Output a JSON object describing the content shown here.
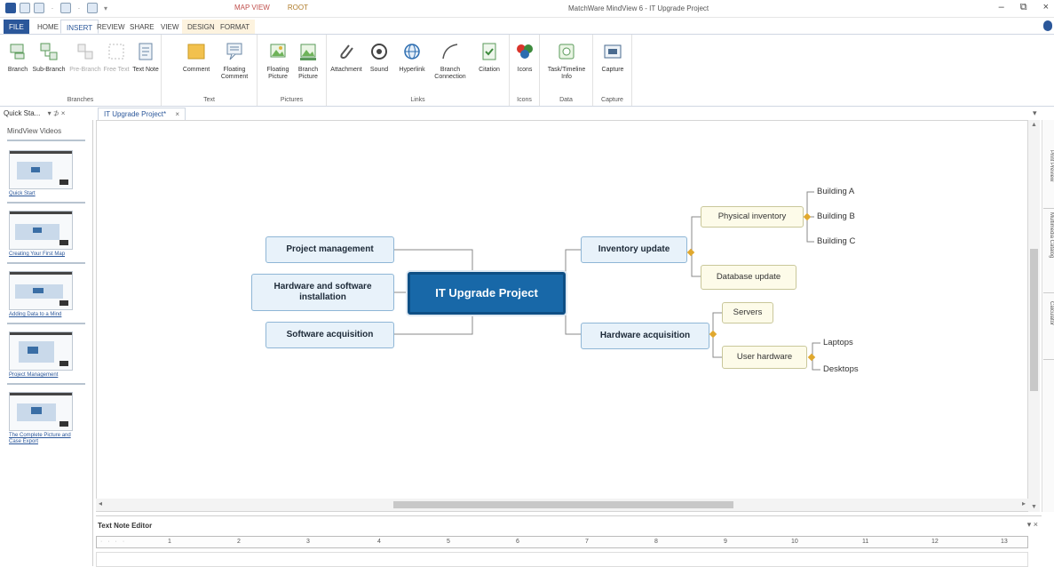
{
  "window": {
    "title": "MatchWare MindView 6 - IT Upgrade Project",
    "context_tab_label": "MAP VIEW",
    "context_tab_root": "ROOT",
    "controls": {
      "minimize": "–",
      "restore": "⧉",
      "close": "×"
    }
  },
  "ribbon_tabs": [
    "FILE",
    "HOME",
    "INSERT",
    "REVIEW",
    "SHARE",
    "VIEW",
    "DESIGN",
    "FORMAT"
  ],
  "active_tab": "INSERT",
  "ribbon": {
    "groups": [
      {
        "label": "Branches",
        "buttons": [
          "Branch",
          "Sub-Branch",
          "Pre-Branch",
          "Free Text",
          "Text Note"
        ]
      },
      {
        "label": "Text",
        "buttons": [
          "Comment",
          "Floating Comment"
        ]
      },
      {
        "label": "Pictures",
        "buttons": [
          "Floating Picture",
          "Branch Picture"
        ]
      },
      {
        "label": "Links",
        "buttons": [
          "Attachment",
          "Sound",
          "Hyperlink",
          "Branch Connection",
          "Citation"
        ]
      },
      {
        "label": "Icons",
        "buttons": [
          "Icons"
        ]
      },
      {
        "label": "Data",
        "buttons": [
          "Task/Timeline Info"
        ]
      },
      {
        "label": "Capture",
        "buttons": [
          "Capture"
        ]
      }
    ]
  },
  "quick_start": {
    "header": "Quick Sta...",
    "header_controls": "▾ ⊅ ×",
    "title": "MindView Videos",
    "items": [
      {
        "caption": "Quick Start"
      },
      {
        "caption": "Creating Your First Map"
      },
      {
        "caption": "Adding Data to a Mind"
      },
      {
        "caption": "Project Management"
      },
      {
        "caption": "The Complete Picture and Case Export"
      }
    ]
  },
  "document_tab": {
    "label": "IT Upgrade Project*",
    "close": "×"
  },
  "mindmap": {
    "central": "IT Upgrade Project",
    "left_branches": [
      "Project management",
      "Hardware and software installation",
      "Software acquisition"
    ],
    "right_branches": [
      {
        "label": "Inventory update",
        "children": [
          {
            "label": "Physical inventory",
            "children": [
              "Building A",
              "Building B",
              "Building C"
            ]
          },
          {
            "label": "Database update",
            "children": []
          }
        ]
      },
      {
        "label": "Hardware acquisition",
        "children": [
          {
            "label": "Servers",
            "children": []
          },
          {
            "label": "User hardware",
            "children": [
              "Laptops",
              "Desktops"
            ]
          }
        ]
      }
    ]
  },
  "side_tabs": [
    "Print Preview",
    "Multimedia Catalog",
    "Calculator"
  ],
  "text_note_editor": {
    "title": "Text Note Editor",
    "controls": "▾ ×",
    "ruler_numbers": [
      "1",
      "2",
      "3",
      "4",
      "5",
      "6",
      "7",
      "8",
      "9",
      "10",
      "11",
      "12",
      "13"
    ]
  },
  "colors": {
    "accent": "#2b579a",
    "central_node": "#1868a8",
    "branch_node": "#e8f2fa",
    "sub_node": "#fdfbe9",
    "connector": "#e0a82e"
  }
}
